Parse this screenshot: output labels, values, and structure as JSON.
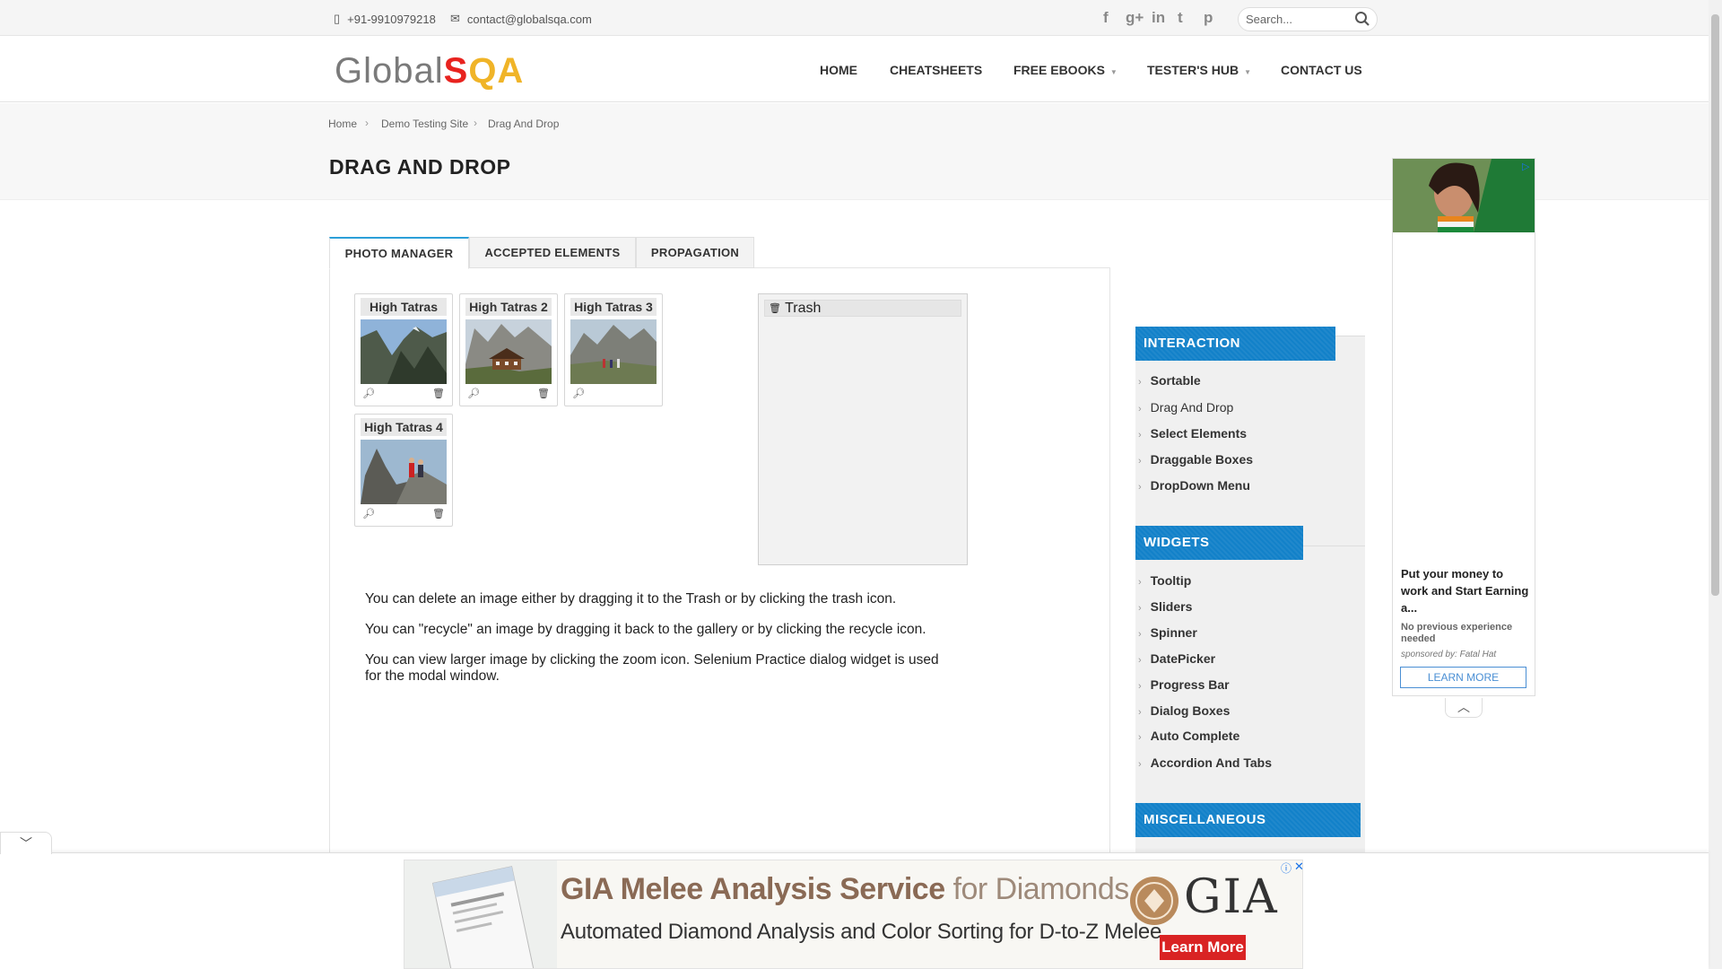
{
  "topbar": {
    "phone": "+91-9910979218",
    "email": "contact@globalsqa.com",
    "socials": [
      "facebook-icon",
      "google-plus-icon",
      "linkedin-icon",
      "twitter-icon",
      "pinterest-icon"
    ],
    "social_glyphs": [
      "f",
      "g+",
      "in",
      "t",
      "p"
    ],
    "search_placeholder": "Search..."
  },
  "header": {
    "logo_global": "Global",
    "logo_s": "S",
    "logo_qa": "QA",
    "nav": [
      "HOME",
      "CHEATSHEETS",
      "FREE EBOOKS",
      "TESTER'S HUB",
      "CONTACT US"
    ]
  },
  "breadcrumb": [
    "Home",
    "Demo Testing Site",
    "Drag And Drop"
  ],
  "page_title": "DRAG AND DROP",
  "tabs": [
    "PHOTO MANAGER",
    "ACCEPTED ELEMENTS",
    "PROPAGATION"
  ],
  "gallery": [
    {
      "title": "High Tatras"
    },
    {
      "title": "High Tatras 2"
    },
    {
      "title": "High Tatras 3"
    },
    {
      "title": "High Tatras 4"
    }
  ],
  "trash_title": "Trash",
  "instructions": [
    "You can delete an image either by dragging it to the Trash or by clicking the trash icon.",
    "You can \"recycle\" an image by dragging it back to the gallery or by clicking the recycle icon.",
    "You can view larger image by clicking the zoom icon. Selenium Practice dialog widget is used for the modal window."
  ],
  "sidebar": {
    "interaction_title": "INTERACTION",
    "interaction_items": [
      "Sortable",
      "Drag And Drop",
      "Select Elements",
      "Draggable Boxes",
      "DropDown Menu"
    ],
    "widgets_title": "WIDGETS",
    "widgets_items": [
      "Tooltip",
      "Sliders",
      "Spinner",
      "DatePicker",
      "Progress Bar",
      "Dialog Boxes",
      "Auto Complete",
      "Accordion And Tabs"
    ],
    "misc_title": "MISCELLANEOUS"
  },
  "ad_right": {
    "title": "Put your money to work and Start Earning a...",
    "subtitle": "No previous experience needed",
    "sponsor": "sponsored by: Fatal Hat",
    "button": "LEARN MORE"
  },
  "ad_bottom": {
    "line1_bold": "GIA Melee Analysis Service",
    "line1_light": "for Diamonds",
    "line2": "Automated Diamond Analysis and Color Sorting for D-to-Z Melee",
    "logo": "GIA",
    "button": "Learn More"
  },
  "colors": {
    "accent_blue": "#1281c9",
    "tab_active": "#2b9fd8",
    "logo_red": "#e8231f",
    "logo_yellow": "#f0b428",
    "ad_button_red": "#d92323"
  }
}
